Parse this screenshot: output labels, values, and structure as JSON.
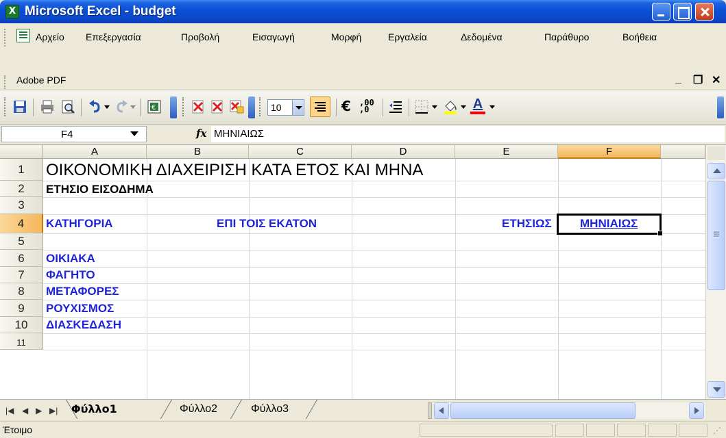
{
  "window": {
    "title": "Microsoft Excel - budget"
  },
  "menu": {
    "items": [
      "Αρχείο",
      "Επεξεργασία",
      "Προβολή",
      "Εισαγωγή",
      "Μορφή",
      "Εργαλεία",
      "Δεδομένα",
      "Παράθυρο",
      "Βοήθεια"
    ],
    "row2": "Adobe PDF"
  },
  "toolbar": {
    "font_size": "10"
  },
  "formula_bar": {
    "name_box": "F4",
    "fx": "fx",
    "content": "ΜΗΝΙΑΙΩΣ"
  },
  "grid": {
    "columns": [
      "A",
      "B",
      "C",
      "D",
      "E",
      "F"
    ],
    "rows": [
      "1",
      "2",
      "3",
      "4",
      "5",
      "6",
      "7",
      "8",
      "9",
      "10",
      "11"
    ],
    "selected_cell": "F4",
    "cells": {
      "a1": "ΟΙΚΟΝΟΜΙΚΗ ΔΙΑΧΕΙΡΙΣΗ ΚΑΤΑ ΕΤΟΣ ΚΑΙ ΜΗΝΑ",
      "a2": "ΕΤΗΣΙΟ ΕΙΣΟΔΗΜΑ",
      "a4": "ΚΑΤΗΓΟΡΙΑ",
      "b4": "ΕΠΙ ΤΟΙΣ ΕΚΑΤΟΝ",
      "e4": "ΕΤΗΣΙΩΣ",
      "f4": "ΜΗΝΙΑΙΩΣ",
      "a6": "ΟΙΚΙΑΚΑ",
      "a7": "ΦΑΓΗΤΟ",
      "a8": "ΜΕΤΑΦΟΡΕΣ",
      "a9": "ΡΟΥΧΙΣΜΟΣ",
      "a10": "ΔΙΑΣΚΕΔΑΣΗ"
    }
  },
  "sheets": [
    "Φύλλο1",
    "Φύλλο2",
    "Φύλλο3"
  ],
  "status": {
    "text": "Έτοιμο"
  },
  "colors": {
    "label_blue": "#1f24d6",
    "selection_orange": "#f5b75b",
    "title_blue": "#0a4fd6"
  }
}
